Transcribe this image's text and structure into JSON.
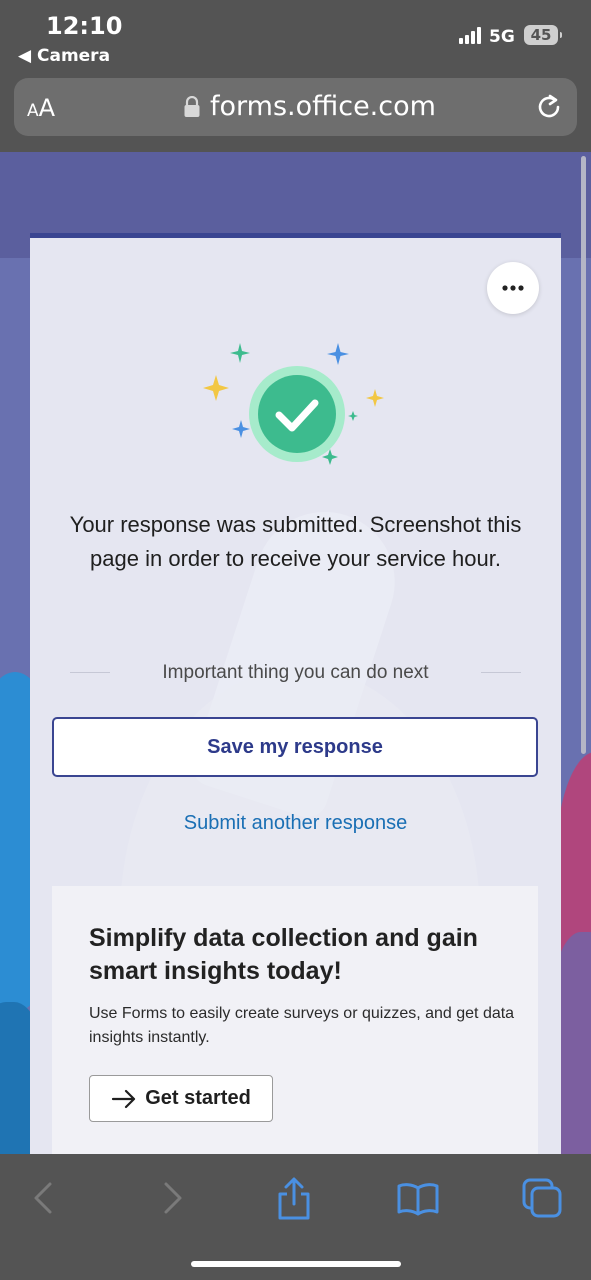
{
  "status_bar": {
    "time": "12:10",
    "back_app": "◀ Camera",
    "network": "5G",
    "battery": "45"
  },
  "browser": {
    "text_size_button": "AA",
    "url": "forms.office.com"
  },
  "confirmation": {
    "message": "Your response was submitted. Screenshot this page in order to receive your service hour.",
    "divider_text": "Important thing you can do next",
    "save_button": "Save my response",
    "submit_another_link": "Submit another response"
  },
  "promo": {
    "headline": "Simplify data collection and gain smart insights today!",
    "body": "Use Forms to easily create surveys or quizzes, and get data insights instantly.",
    "cta": "Get started"
  },
  "icons": {
    "lock": "lock-icon",
    "reload": "reload-icon",
    "more": "more-options-icon",
    "check": "check-circle-icon",
    "arrow": "arrow-right-icon",
    "back": "chevron-left-icon",
    "forward": "chevron-right-icon",
    "share": "share-icon",
    "bookmarks": "book-icon",
    "tabs": "tabs-icon"
  },
  "colors": {
    "accent": "#3a4591",
    "link": "#1a6fb4",
    "check_green": "#3dbb8e",
    "ios_blue": "#4a90e2"
  }
}
